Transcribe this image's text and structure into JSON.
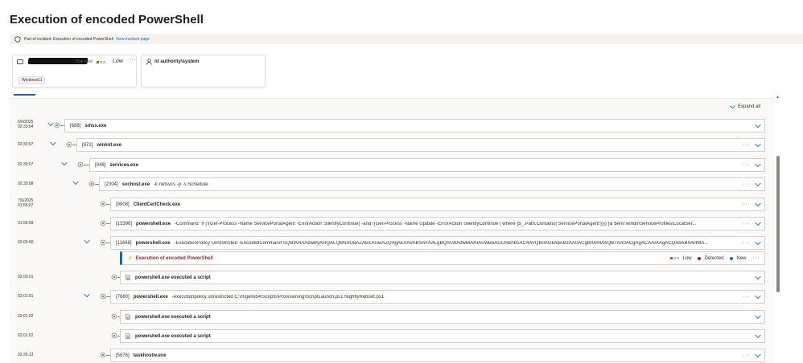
{
  "page": {
    "title": "Execution of encoded PowerShell"
  },
  "incident_bar": {
    "label": "Part of incident: Execution of encoded PowerShell",
    "link": "View incident page"
  },
  "device_card": {
    "risk_label": "Risk level",
    "risk_value": "Low",
    "os_tag": "Windows11",
    "more": "···",
    "risk_color": "#ca5010",
    "risk_bar_empty": "#c8c6c4"
  },
  "user_card": {
    "name": "nt authority\\system"
  },
  "tree": {
    "expand_all": "Expand all",
    "rows": [
      {
        "ts": [
          "6/6/2025",
          "02:33:04"
        ],
        "pid": "[688]",
        "name": "smss.exe",
        "args": "",
        "more": ""
      },
      {
        "ts": [
          "02:33:07"
        ],
        "pid": "[872]",
        "name": "wininit.exe",
        "args": "",
        "more": "···"
      },
      {
        "ts": [
          "02:33:07"
        ],
        "pid": "[948]",
        "name": "services.exe",
        "args": "",
        "more": "···"
      },
      {
        "ts": [
          "02:33:08"
        ],
        "pid": "[2304]",
        "name": "svchost.exe",
        "args": "-k netsvcs -p -s Schedule",
        "more": "···"
      },
      {
        "ts": [
          "7/6/2025",
          "01:55:07"
        ],
        "pid": "[9908]",
        "name": "ClientCertCheck.exe",
        "args": "",
        "more": "···"
      },
      {
        "ts": [
          "01:59:09"
        ],
        "pid": "[13396]",
        "name": "powershell.exe",
        "args": "-Command \"if (!(Get-Process -Name ServicePortalAgent -ErrorAction SilentlyContinue) -and !(Get-Process -Name Update -ErrorAction SilentlyContinue | where {$_.Path.Contains('ServicePortalAgent')})) {& $env:windir\\ServiceProfiles\\LocalSer...",
        "more": "···"
      },
      {
        "ts": [
          "02:00:00"
        ],
        "pid": "[11668]",
        "name": "powershell.exe",
        "args": "-ExecutionPolicy Unrestricted -EncodedCommand SQBtAHAAbwByAHQALQBNAG8AZAB1AGwAZQAgAE0AVABSAFAALgBQAG8AdwBlAHIAUwBoAGUAbABsAC4AVQB0AGkAbABzAA0ACgB0AHIAeQB7AA0ACgAgACAAIAAgACQAbABhAHMA...",
        "more": "···"
      },
      {
        "alert": true,
        "title": "Execution of encoded PowerShell",
        "severity": "Low",
        "status": "Detected",
        "classification": "New",
        "more": "···"
      },
      {
        "ts": [
          "02:00:01"
        ],
        "script": "powershell.exe executed a script"
      },
      {
        "ts": [
          "02:01:01"
        ],
        "pid": "[7680]",
        "name": "powershell.exe",
        "args": "-executionpolicy unrestricted C:\\Rigel\\x64\\Scripts\\Provisioning\\ScriptLaunch.ps1 NightlyReboot.ps1",
        "more": "···"
      },
      {
        "ts": [
          "02:01:02"
        ],
        "script": "powershell.exe executed a script"
      },
      {
        "ts": [
          "02:01:02"
        ],
        "script": "powershell.exe executed a script"
      },
      {
        "ts": [
          "02:26:13"
        ],
        "pid": "[5876]",
        "name": "taskhostw.exe",
        "args": "",
        "more": "···"
      }
    ]
  },
  "colors": {
    "accent": "#0f6cbd",
    "alert_red": "#a4262c",
    "detected_red": "#c50f1f",
    "new_blue": "#0f6cbd",
    "severity_orange": "#ca5010"
  }
}
